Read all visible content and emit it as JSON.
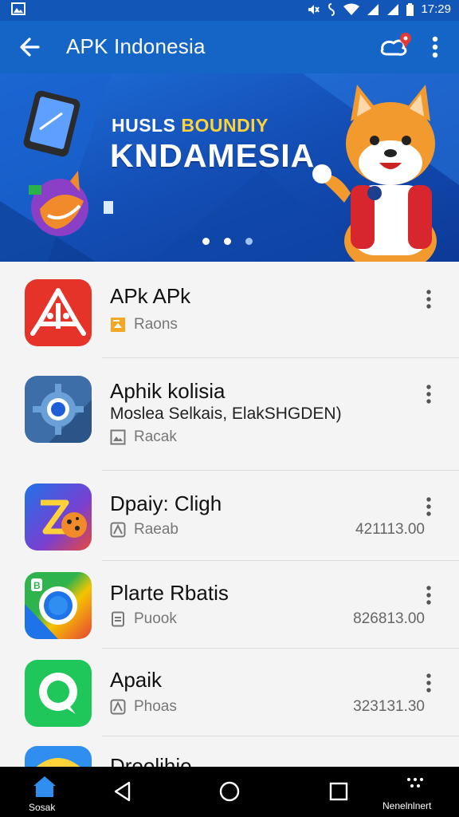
{
  "status_bar": {
    "left_icon": "gallery-icon",
    "time": "17:29"
  },
  "app_bar": {
    "title": "APK Indonesia",
    "back_icon": "arrow-left-icon",
    "cast_icon": "cast-icon",
    "menu_icon": "more-vert-icon"
  },
  "banner": {
    "line1_white": "HUSLS ",
    "line1_accent": "BOUNDIY",
    "line2": "KNDAMESIA",
    "page_count": 3,
    "active_page": 1
  },
  "apps": [
    {
      "name": "APk APk",
      "desc": "",
      "meta": "Raons",
      "meta_icon": "star-box-icon",
      "size": ""
    },
    {
      "name": "Aphik kolisia",
      "desc": "Moslea Selkais, ElakSHGDEN)",
      "meta": "Racak",
      "meta_icon": "image-icon",
      "size": ""
    },
    {
      "name": "Dpaiy: Cligh",
      "desc": "",
      "meta": "Raeab",
      "meta_icon": "rating-icon",
      "size": "421113.00"
    },
    {
      "name": "Plarte Rbatis",
      "desc": "",
      "meta": "Puook",
      "meta_icon": "document-icon",
      "size": "826813.00"
    },
    {
      "name": "Apaik",
      "desc": "",
      "meta": "Phoas",
      "meta_icon": "rating-icon",
      "size": "323131.30"
    },
    {
      "name": "Dreolihio",
      "desc": "",
      "meta": "",
      "meta_icon": "",
      "size": ""
    }
  ],
  "colors": {
    "primary": "#1565c7",
    "status_bar": "#1257b8",
    "accent_yellow": "#ffd23a"
  },
  "nav": {
    "home_label": "Sosak",
    "back_icon": "triangle-back-icon",
    "home_circle_icon": "circle-home-icon",
    "recents_icon": "square-recents-icon",
    "more_label": "Nenelnlnert"
  }
}
